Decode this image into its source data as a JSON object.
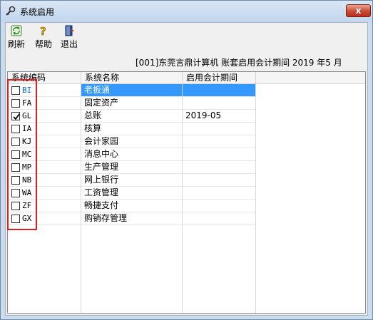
{
  "window": {
    "title": "系统启用",
    "close_label": "x"
  },
  "toolbar": {
    "refresh_label": "刷新",
    "help_label": "帮助",
    "exit_label": "退出"
  },
  "period_info": "[001]东莞言鼎计算机 账套启用会计期间 2019 年5 月",
  "table": {
    "columns": [
      "系统编码",
      "系统名称",
      "启用会计期间"
    ],
    "rows": [
      {
        "code": "BI",
        "name": "老板通",
        "period": "",
        "checked": false,
        "selected": true
      },
      {
        "code": "FA",
        "name": "固定资产",
        "period": "",
        "checked": false,
        "selected": false
      },
      {
        "code": "GL",
        "name": "总账",
        "period": "2019-05",
        "checked": true,
        "selected": false
      },
      {
        "code": "IA",
        "name": "核算",
        "period": "",
        "checked": false,
        "selected": false
      },
      {
        "code": "KJ",
        "name": "会计家园",
        "period": "",
        "checked": false,
        "selected": false
      },
      {
        "code": "MC",
        "name": "消息中心",
        "period": "",
        "checked": false,
        "selected": false
      },
      {
        "code": "MP",
        "name": "生产管理",
        "period": "",
        "checked": false,
        "selected": false
      },
      {
        "code": "NB",
        "name": "网上银行",
        "period": "",
        "checked": false,
        "selected": false
      },
      {
        "code": "WA",
        "name": "工资管理",
        "period": "",
        "checked": false,
        "selected": false
      },
      {
        "code": "ZF",
        "name": "畅捷支付",
        "period": "",
        "checked": false,
        "selected": false
      },
      {
        "code": "GX",
        "name": "购销存管理",
        "period": "",
        "checked": false,
        "selected": false
      }
    ]
  },
  "colors": {
    "selection": "#3399ff",
    "highlight": "#e02020",
    "close_button": "#c94a33"
  }
}
